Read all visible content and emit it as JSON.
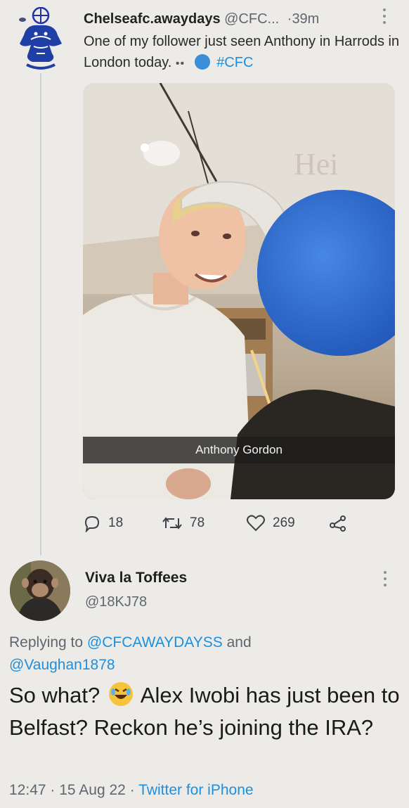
{
  "tweet": {
    "display_name": "Chelseafc.awaydays",
    "handle": "@CFC...",
    "separator": "·",
    "time": "39m",
    "text": "One of my follower just seen Anthony in Harrods in London today.",
    "text_trailing_dots": "••",
    "hashtag": "#CFC",
    "photo_caption": "Anthony  Gordon",
    "replies_count": "18",
    "retweets_count": "78",
    "likes_count": "269",
    "icons": {
      "avatar": "lion-crest-icon",
      "reply": "reply-bubble-icon",
      "retweet": "retweet-icon",
      "like": "heart-icon",
      "share": "share-icon",
      "more": "more-vertical-icon"
    }
  },
  "reply": {
    "display_name": "Viva la Toffees",
    "handle": "@18KJ78",
    "replying_to_prefix": "Replying to",
    "mention1": "@CFCAWAYDAYSS",
    "and_word": "and",
    "mention2": "@Vaughan1878",
    "text_part1": "So what?",
    "text_part2": "Alex Iwobi has just been to Belfast? Reckon he’s joining the IRA?",
    "emoji": "rolling-on-floor-laughing",
    "time": "12:47",
    "date": "15 Aug 22",
    "meta_separator": "·",
    "source": "Twitter for iPhone"
  },
  "colors": {
    "link": "#1d8fdf",
    "muted": "#5e6770",
    "background": "#ecebe7",
    "avatar_blue": "#1f3f9e"
  }
}
